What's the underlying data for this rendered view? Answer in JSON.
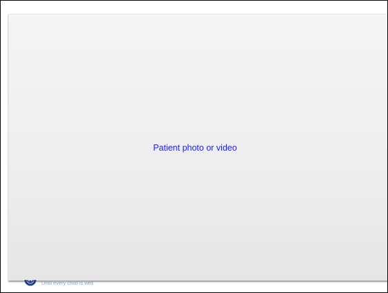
{
  "slide": {
    "placeholder_text": "Patient photo or video"
  },
  "footer": {
    "logo_icon": "hospital-logo-icon",
    "tagline": "Until every child is well"
  },
  "colors": {
    "placeholder_text": "#1a1aff",
    "tagline": "#7fa6cf",
    "logo": "#1e3f8c"
  }
}
